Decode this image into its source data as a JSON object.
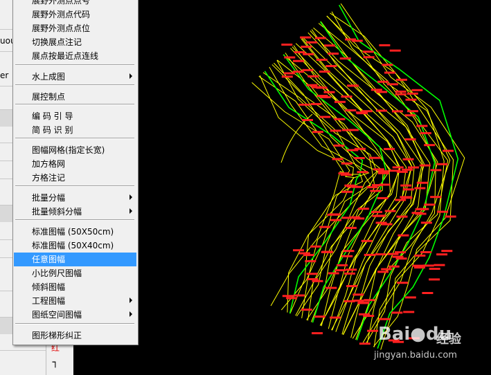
{
  "left_panel": {
    "fragments": [
      "uou",
      "er",
      "红"
    ]
  },
  "context_menu": {
    "items": [
      {
        "label": "展野外测点点号",
        "submenu": false,
        "selected": false
      },
      {
        "label": "展野外测点代码",
        "submenu": false,
        "selected": false
      },
      {
        "label": "展野外测点点位",
        "submenu": false,
        "selected": false
      },
      {
        "label": "切换展点注记",
        "submenu": false,
        "selected": false
      },
      {
        "label": "展点按最近点连线",
        "submenu": false,
        "selected": false
      },
      {
        "label": "水上成图",
        "submenu": true,
        "selected": false
      },
      {
        "label": "展控制点",
        "submenu": false,
        "selected": false
      },
      {
        "label": "编 码 引 导",
        "submenu": false,
        "selected": false
      },
      {
        "label": "简 码 识 别",
        "submenu": false,
        "selected": false
      },
      {
        "label": "图幅网格(指定长宽)",
        "submenu": false,
        "selected": false
      },
      {
        "label": "加方格网",
        "submenu": false,
        "selected": false
      },
      {
        "label": "方格注记",
        "submenu": false,
        "selected": false
      },
      {
        "label": "批量分幅",
        "submenu": true,
        "selected": false
      },
      {
        "label": "批量倾斜分幅",
        "submenu": true,
        "selected": false
      },
      {
        "label": "标准图幅 (50X50cm)",
        "submenu": false,
        "selected": false
      },
      {
        "label": "标准图幅 (50X40cm)",
        "submenu": false,
        "selected": false
      },
      {
        "label": "任意图幅",
        "submenu": false,
        "selected": true
      },
      {
        "label": "小比例尺图幅",
        "submenu": false,
        "selected": false
      },
      {
        "label": "倾斜图幅",
        "submenu": false,
        "selected": false
      },
      {
        "label": "工程图幅",
        "submenu": true,
        "selected": false
      },
      {
        "label": "图纸空间图幅",
        "submenu": true,
        "selected": false
      },
      {
        "label": "图形梯形纠正",
        "submenu": false,
        "selected": false
      }
    ]
  },
  "watermark": {
    "logo": "Bai●du",
    "text": "经验",
    "url": "jingyan.baidu.com"
  },
  "colors": {
    "canvas_bg": "#000000",
    "contour": "#ffff00",
    "index_contour": "#00ff00",
    "survey_points": "#ff2020",
    "menu_highlight": "#3399ff"
  }
}
